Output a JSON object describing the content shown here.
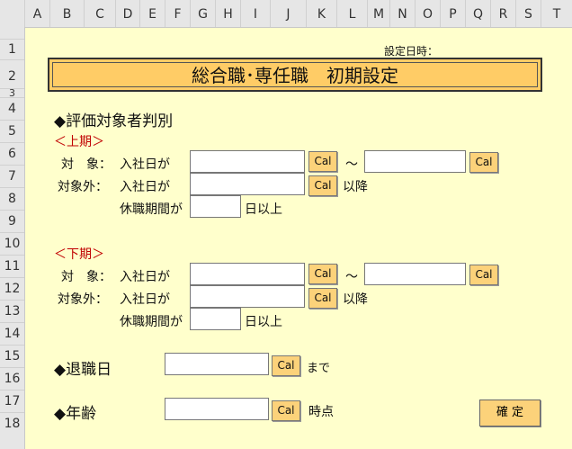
{
  "columns": [
    "A",
    "B",
    "C",
    "D",
    "E",
    "F",
    "G",
    "H",
    "I",
    "J",
    "K",
    "L",
    "M",
    "N",
    "O",
    "P",
    "Q",
    "R",
    "S",
    "T"
  ],
  "rows": [
    "1",
    "2",
    "3",
    "4",
    "5",
    "6",
    "7",
    "8",
    "9",
    "10",
    "11",
    "12",
    "13",
    "14",
    "15",
    "16",
    "17",
    "18"
  ],
  "form": {
    "setting_date_label": "設定日時：",
    "title": "総合職･専任職　初期設定",
    "eval_heading": "◆評価対象者判別",
    "first_half": "＜上期＞",
    "second_half": "＜下期＞",
    "taisho": "対　象：",
    "taishogai": "対象外：",
    "nyusha": "入社日が",
    "kyushoku": "休職期間が",
    "tilde": "～",
    "ikou": "以降",
    "nichi_ijou": "日以上",
    "retire_heading": "◆退職日",
    "made": "まで",
    "age_heading": "◆年齢",
    "jiten": "時点",
    "cal_label": "Cal",
    "confirm_label": "確 定"
  },
  "colors": {
    "sheet_bg": "#ffffcc",
    "title_bg": "#ffcc66",
    "button_bg": "#fcd27a",
    "red_text": "#c00000"
  }
}
